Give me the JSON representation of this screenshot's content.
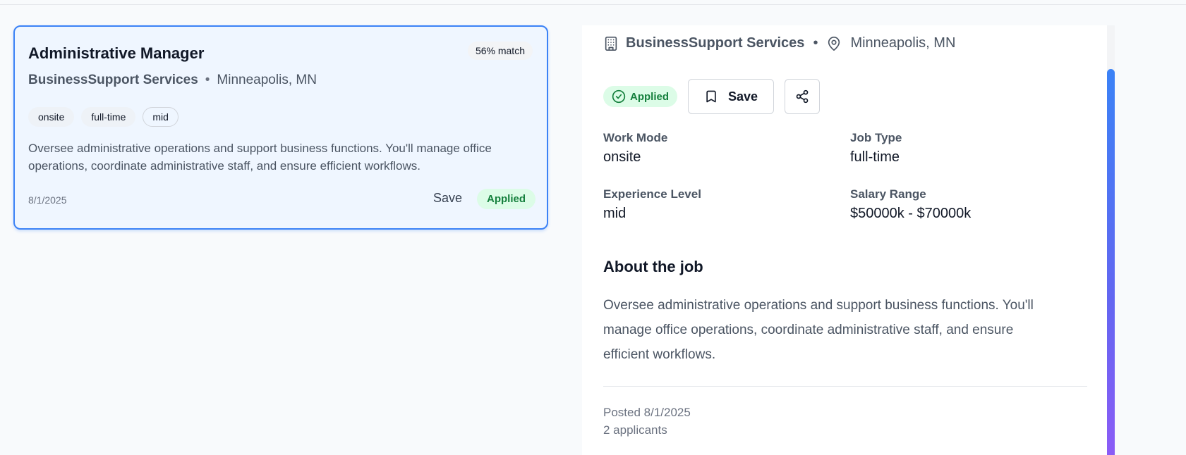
{
  "job_card": {
    "title": "Administrative Manager",
    "match": "56% match",
    "company": "BusinessSupport Services",
    "separator": "•",
    "location": "Minneapolis, MN",
    "tags": [
      "onsite",
      "full-time",
      "mid"
    ],
    "description": "Oversee administrative operations and support business functions. You'll manage office operations, coordinate administrative staff, and ensure efficient workflows.",
    "date": "8/1/2025",
    "save_label": "Save",
    "status": "Applied"
  },
  "detail": {
    "company": "BusinessSupport Services",
    "separator": "•",
    "location": "Minneapolis, MN",
    "status": "Applied",
    "save_label": "Save",
    "fields": {
      "work_mode": {
        "label": "Work Mode",
        "value": "onsite"
      },
      "job_type": {
        "label": "Job Type",
        "value": "full-time"
      },
      "experience": {
        "label": "Experience Level",
        "value": "mid"
      },
      "salary": {
        "label": "Salary Range",
        "value": "$50000k - $70000k"
      }
    },
    "about_title": "About the job",
    "about_body": "Oversee administrative operations and support business functions. You'll manage office operations, coordinate administrative staff, and ensure efficient workflows.",
    "posted": "Posted 8/1/2025",
    "applicants": "2 applicants"
  },
  "colors": {
    "accent": "#3b82f6",
    "applied_bg": "#dcfce7",
    "applied_text": "#15803d",
    "scroll_gradient_end": "#8b5cf6"
  },
  "icons": {
    "company": "building-icon",
    "location": "map-pin-icon",
    "applied": "check-circle-icon",
    "save": "bookmark-icon",
    "share": "share-icon"
  }
}
